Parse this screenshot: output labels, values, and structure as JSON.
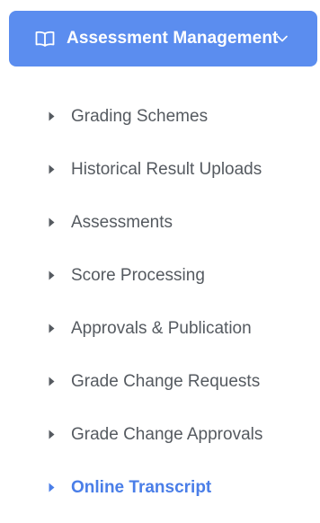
{
  "sidebar": {
    "section": {
      "title": "Assessment Management",
      "icon": "book-open-icon",
      "expand_icon": "chevron-down-icon",
      "header_color": "#5b8def"
    },
    "items": [
      {
        "label": "Grading Schemes",
        "icon": "caret-right-icon"
      },
      {
        "label": "Historical Result Uploads",
        "icon": "caret-right-icon"
      },
      {
        "label": "Assessments",
        "icon": "caret-right-icon"
      },
      {
        "label": "Score Processing",
        "icon": "caret-right-icon"
      },
      {
        "label": "Approvals & Publication",
        "icon": "caret-right-icon"
      },
      {
        "label": "Grade Change Requests",
        "icon": "caret-right-icon"
      },
      {
        "label": "Grade Change Approvals",
        "icon": "caret-right-icon"
      },
      {
        "label": "Online Transcript",
        "icon": "caret-right-icon",
        "active": true
      }
    ],
    "colors": {
      "item_text": "#555a60",
      "active_text": "#4a7ee8"
    }
  }
}
